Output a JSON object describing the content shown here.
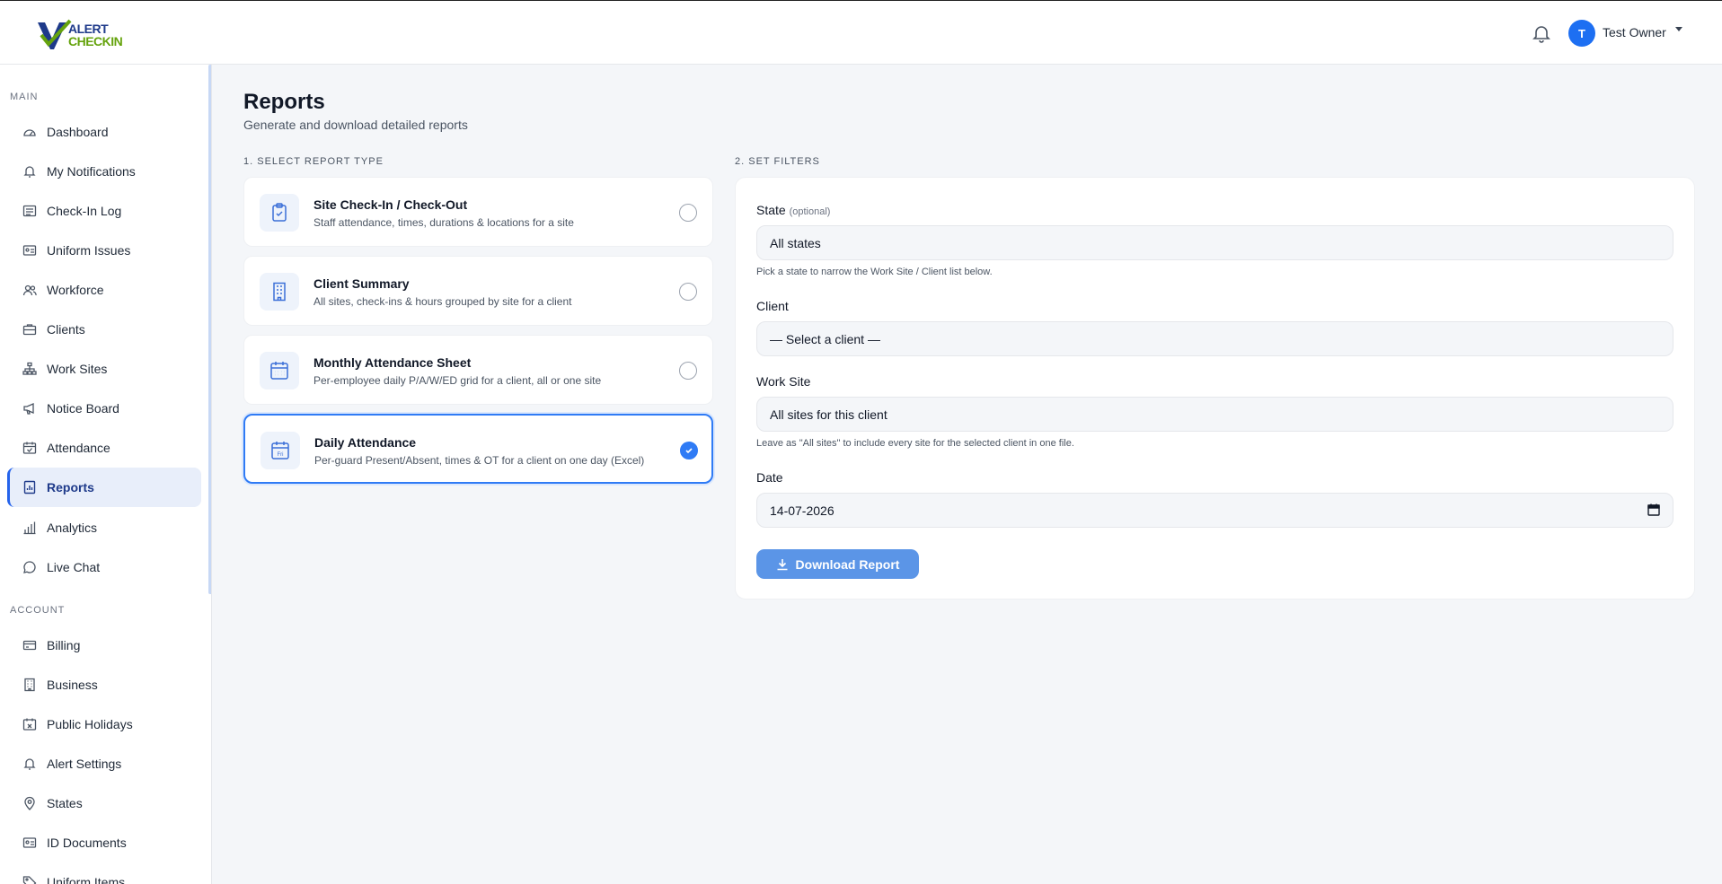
{
  "brand": {
    "line1": "ALERT",
    "line2": "CHECKIN"
  },
  "header": {
    "user_initial": "T",
    "user_name": "Test Owner"
  },
  "sidebar": {
    "main_label": "MAIN",
    "account_label": "ACCOUNT",
    "main_items": [
      {
        "label": "Dashboard",
        "icon": "gauge-icon"
      },
      {
        "label": "My Notifications",
        "icon": "bell-icon"
      },
      {
        "label": "Check-In Log",
        "icon": "list-icon"
      },
      {
        "label": "Uniform Issues",
        "icon": "id-card-icon"
      },
      {
        "label": "Workforce",
        "icon": "users-icon"
      },
      {
        "label": "Clients",
        "icon": "briefcase-icon"
      },
      {
        "label": "Work Sites",
        "icon": "sitemap-icon"
      },
      {
        "label": "Notice Board",
        "icon": "megaphone-icon"
      },
      {
        "label": "Attendance",
        "icon": "calendar-check-icon"
      },
      {
        "label": "Reports",
        "icon": "report-icon",
        "active": true
      },
      {
        "label": "Analytics",
        "icon": "bar-chart-icon"
      },
      {
        "label": "Live Chat",
        "icon": "chat-icon"
      }
    ],
    "account_items": [
      {
        "label": "Billing",
        "icon": "credit-card-icon"
      },
      {
        "label": "Business",
        "icon": "building-icon"
      },
      {
        "label": "Public Holidays",
        "icon": "calendar-x-icon"
      },
      {
        "label": "Alert Settings",
        "icon": "bell-icon"
      },
      {
        "label": "States",
        "icon": "map-pin-icon"
      },
      {
        "label": "ID Documents",
        "icon": "id-card-icon"
      },
      {
        "label": "Uniform Items",
        "icon": "tag-icon"
      }
    ]
  },
  "page": {
    "title": "Reports",
    "subtitle": "Generate and download detailed reports",
    "step1_label": "1. SELECT REPORT TYPE",
    "step2_label": "2. SET FILTERS"
  },
  "report_types": [
    {
      "title": "Site Check-In / Check-Out",
      "desc": "Staff attendance, times, durations & locations for a site",
      "icon": "clipboard-check-icon",
      "selected": false
    },
    {
      "title": "Client Summary",
      "desc": "All sites, check-ins & hours grouped by site for a client",
      "icon": "building-icon",
      "selected": false
    },
    {
      "title": "Monthly Attendance Sheet",
      "desc": "Per-employee daily P/A/W/ED grid for a client, all or one site",
      "icon": "calendar-grid-icon",
      "selected": false
    },
    {
      "title": "Daily Attendance",
      "desc": "Per-guard Present/Absent, times & OT for a client on one day (Excel)",
      "icon": "calendar-day-icon",
      "icon_text": "Fri",
      "selected": true
    }
  ],
  "filters": {
    "state_label": "State",
    "state_optional": "(optional)",
    "state_value": "All states",
    "state_help": "Pick a state to narrow the Work Site / Client list below.",
    "client_label": "Client",
    "client_value": "— Select a client —",
    "site_label": "Work Site",
    "site_value": "All sites for this client",
    "site_help": "Leave as \"All sites\" to include every site for the selected client in one file.",
    "date_label": "Date",
    "date_value": "14-07-2026",
    "download_label": "Download Report"
  },
  "colors": {
    "primary": "#2f7bf5",
    "button": "#5b95e7",
    "brand_blue": "#1e3a8a",
    "brand_green": "#65a30d"
  }
}
